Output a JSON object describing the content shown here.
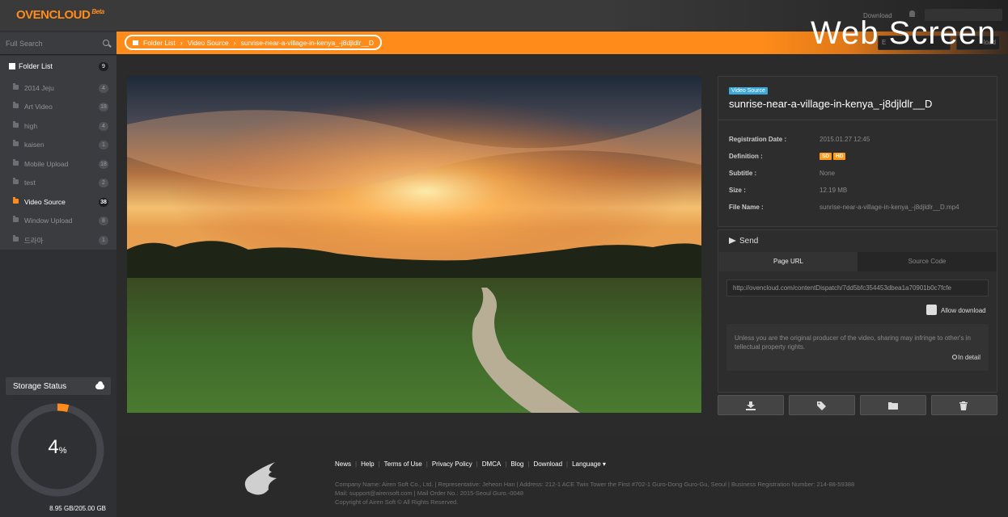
{
  "app": {
    "logo": "OVENCLOUD",
    "beta": "Beta",
    "top_download": "Download",
    "overlay_title": "Web Screen"
  },
  "sidebar": {
    "search_placeholder": "Full Search",
    "folder_header": {
      "label": "Folder List",
      "count": "9"
    },
    "folders": [
      {
        "label": "2014 Jeju",
        "count": "4"
      },
      {
        "label": "Art Video",
        "count": "18"
      },
      {
        "label": "high",
        "count": "4"
      },
      {
        "label": "kaisen",
        "count": "1"
      },
      {
        "label": "Mobile Upload",
        "count": "18"
      },
      {
        "label": "test",
        "count": "2"
      },
      {
        "label": "Video Source",
        "count": "38",
        "active": true
      },
      {
        "label": "Window Upload",
        "count": "8"
      },
      {
        "label": "드라마",
        "count": "1"
      }
    ],
    "storage": {
      "title": "Storage Status",
      "percent": "4",
      "percent_unit": "%",
      "percent_value": 0.04,
      "amount": "8.95 GB/205.00 GB"
    }
  },
  "breadcrumb": [
    "Folder List",
    "Video Source",
    "sunrise-near-a-village-in-kenya_-j8djldlr__D"
  ],
  "header_buttons": {
    "left": "E",
    "right": "load"
  },
  "video": {
    "badge": "Video Source",
    "title": "sunrise-near-a-village-in-kenya_-j8djldlr__D",
    "meta": [
      {
        "key": "Registration Date :",
        "value": "2015.01.27 12:45"
      },
      {
        "key": "Definition :",
        "value": ""
      },
      {
        "key": "Subtitle :",
        "value": "None"
      },
      {
        "key": "Size :",
        "value": "12.19 MB"
      },
      {
        "key": "File Name :",
        "value": "sunrise-near-a-village-in-kenya_-j8djldlr__D.mp4"
      }
    ],
    "definitions": [
      "SD",
      "HD"
    ]
  },
  "send": {
    "title": "Send",
    "tabs": [
      "Page URL",
      "Source Code"
    ],
    "url": "http://ovencloud.com/contentDispatch/7dd5bfc354453dbea1a70901b0c7fcfe",
    "allow_download": "Allow download",
    "notice": "Unless you are the original producer of the video, sharing may infringe to other's in tellectual property rights.",
    "detail_link": "In detail"
  },
  "actions": {
    "icons": [
      "download-icon",
      "tag-icon",
      "folder-icon",
      "trash-icon"
    ],
    "accent": "#ff8c1a"
  },
  "footer": {
    "links": [
      "News",
      "Help",
      "Terms of Use",
      "Privacy Policy",
      "DMCA",
      "Blog",
      "Download",
      "Language ▾"
    ],
    "line1": "Company Name: Airen Soft Co., Ltd. | Representative: Jeheon Han | Address: 212-1 ACE Twin Tower the First #702-1 Guro-Dong Guro-Gu, Seoul | Business Registration Number: 214-88-59388",
    "line2": "Mail: support@airensoft.com | Mail Order No.: 2015-Seoul Guro.-0048",
    "line3": "Copyright of Airen Soft © All Rights Reserved."
  }
}
